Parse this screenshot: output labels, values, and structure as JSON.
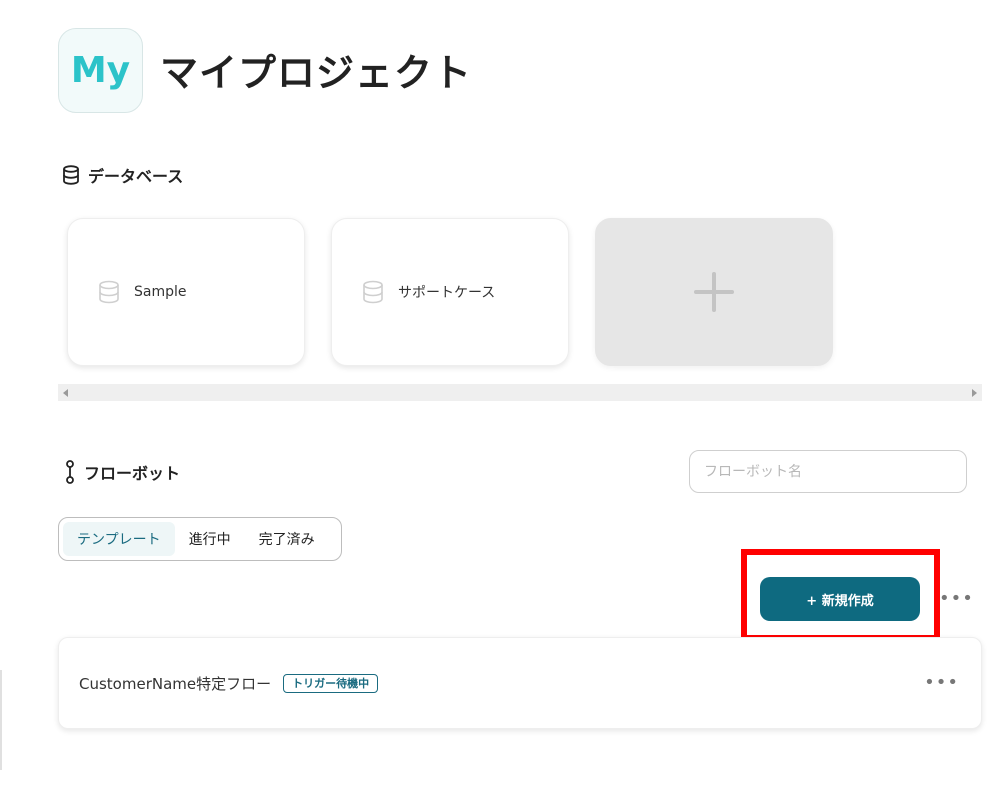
{
  "project": {
    "avatar_text": "My",
    "title": "マイプロジェクト"
  },
  "database_section": {
    "heading": "データベース",
    "icon": "database-icon",
    "items": [
      {
        "name": "Sample"
      },
      {
        "name": "サポートケース"
      }
    ],
    "add_icon": "plus-icon"
  },
  "flowbot_section": {
    "heading": "フローボット",
    "icon": "flow-icon",
    "search": {
      "placeholder": "フローボット名",
      "value": ""
    },
    "tabs": [
      {
        "label": "テンプレート",
        "active": true
      },
      {
        "label": "進行中",
        "active": false
      },
      {
        "label": "完了済み",
        "active": false
      }
    ],
    "new_button_label": "+ 新規作成",
    "more_label": "•••",
    "flows": [
      {
        "name": "CustomerName特定フロー",
        "status": "トリガー待機中",
        "more_label": "•••"
      }
    ]
  },
  "colors": {
    "accent": "#0e6a80",
    "avatar_text": "#2cc3c9",
    "highlight": "#ff0000"
  }
}
